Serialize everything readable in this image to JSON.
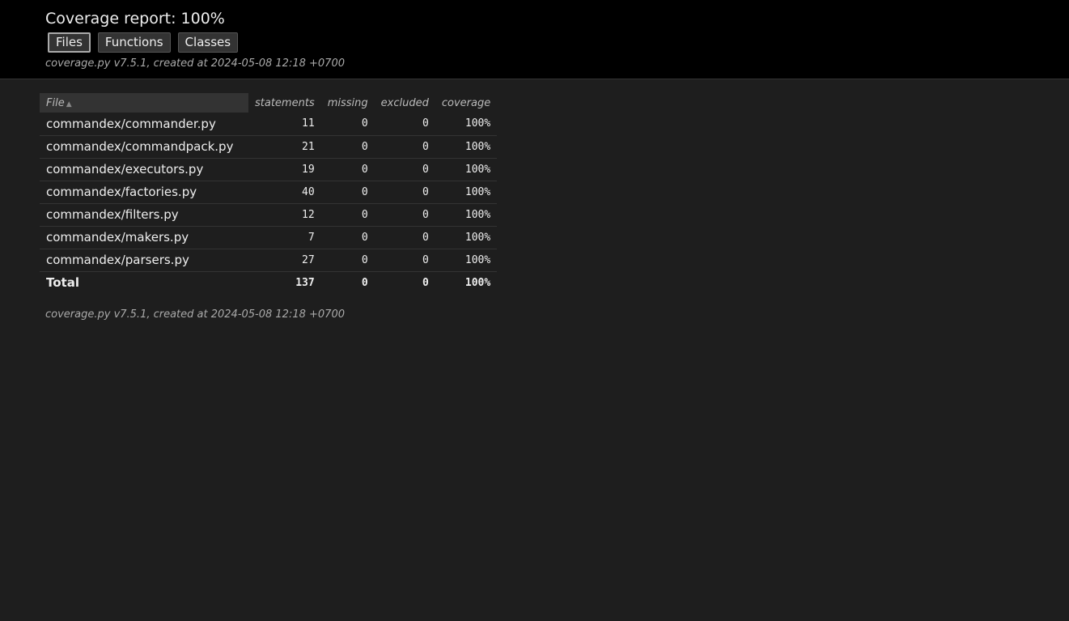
{
  "header": {
    "title": "Coverage report: 100%",
    "nav": {
      "files": "Files",
      "functions": "Functions",
      "classes": "Classes"
    },
    "created": "coverage.py v7.5.1, created at 2024-05-08 12:18 +0700"
  },
  "table": {
    "columns": {
      "file": "File",
      "file_sort_icon": "▲",
      "statements": "statements",
      "missing": "missing",
      "excluded": "excluded",
      "coverage": "coverage"
    },
    "rows": [
      {
        "file": "commandex/commander.py",
        "statements": "11",
        "missing": "0",
        "excluded": "0",
        "coverage": "100%"
      },
      {
        "file": "commandex/commandpack.py",
        "statements": "21",
        "missing": "0",
        "excluded": "0",
        "coverage": "100%"
      },
      {
        "file": "commandex/executors.py",
        "statements": "19",
        "missing": "0",
        "excluded": "0",
        "coverage": "100%"
      },
      {
        "file": "commandex/factories.py",
        "statements": "40",
        "missing": "0",
        "excluded": "0",
        "coverage": "100%"
      },
      {
        "file": "commandex/filters.py",
        "statements": "12",
        "missing": "0",
        "excluded": "0",
        "coverage": "100%"
      },
      {
        "file": "commandex/makers.py",
        "statements": "7",
        "missing": "0",
        "excluded": "0",
        "coverage": "100%"
      },
      {
        "file": "commandex/parsers.py",
        "statements": "27",
        "missing": "0",
        "excluded": "0",
        "coverage": "100%"
      }
    ],
    "total": {
      "label": "Total",
      "statements": "137",
      "missing": "0",
      "excluded": "0",
      "coverage": "100%"
    }
  },
  "footer": {
    "created": "coverage.py v7.5.1, created at 2024-05-08 12:18 +0700"
  }
}
